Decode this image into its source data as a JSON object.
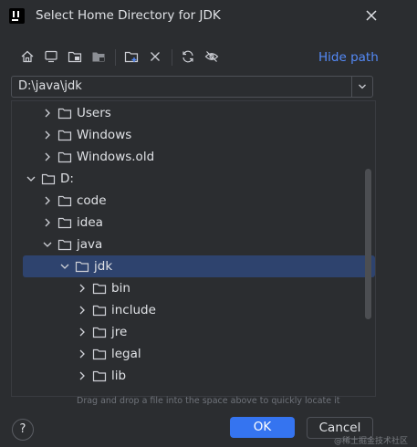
{
  "dialog": {
    "title": "Select Home Directory for JDK",
    "hide_path_label": "Hide path",
    "path_value": "D:\\java\\jdk"
  },
  "toolbar": {
    "buttons": [
      "home-icon",
      "desktop-icon",
      "project-icon",
      "module-icon",
      "new-folder-icon",
      "delete-icon",
      "refresh-icon",
      "show-hidden-icon"
    ]
  },
  "tree": {
    "items": [
      {
        "label": "Users",
        "level": 1,
        "expanded": false,
        "selected": false
      },
      {
        "label": "Windows",
        "level": 1,
        "expanded": false,
        "selected": false
      },
      {
        "label": "Windows.old",
        "level": 1,
        "expanded": false,
        "selected": false
      },
      {
        "label": "D:",
        "level": 0,
        "expanded": true,
        "selected": false
      },
      {
        "label": "code",
        "level": 1,
        "expanded": false,
        "selected": false
      },
      {
        "label": "idea",
        "level": 1,
        "expanded": false,
        "selected": false
      },
      {
        "label": "java",
        "level": 1,
        "expanded": true,
        "selected": false
      },
      {
        "label": "jdk",
        "level": 2,
        "expanded": true,
        "selected": true
      },
      {
        "label": "bin",
        "level": 3,
        "expanded": false,
        "selected": false
      },
      {
        "label": "include",
        "level": 3,
        "expanded": false,
        "selected": false
      },
      {
        "label": "jre",
        "level": 3,
        "expanded": false,
        "selected": false
      },
      {
        "label": "legal",
        "level": 3,
        "expanded": false,
        "selected": false
      },
      {
        "label": "lib",
        "level": 3,
        "expanded": false,
        "selected": false
      }
    ],
    "drop_hint": "Drag and drop a file into the space above to quickly locate it"
  },
  "footer": {
    "help_label": "?",
    "ok_label": "OK",
    "cancel_label": "Cancel"
  },
  "watermark": "@稀土掘金技术社区",
  "colors": {
    "background": "#2b2d30",
    "accent": "#3574f0",
    "link": "#548af7",
    "selection": "#2e436e"
  }
}
